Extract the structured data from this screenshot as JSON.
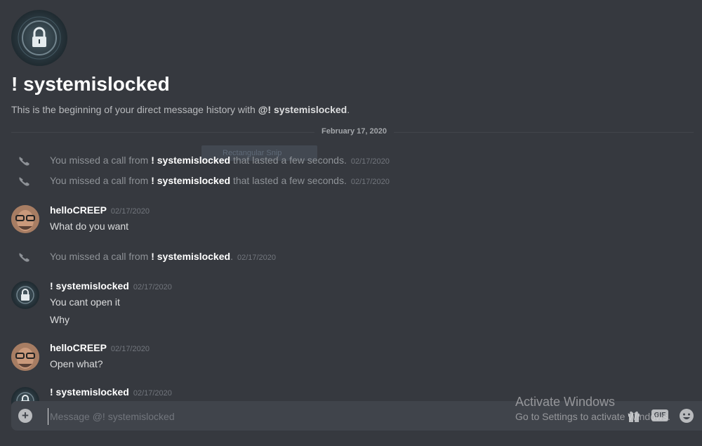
{
  "channel": {
    "title": "! systemislocked",
    "intro_prefix": "This is the beginning of your direct message history with ",
    "intro_mention": "@! systemislocked",
    "intro_suffix": "."
  },
  "divider": {
    "date": "February 17, 2020"
  },
  "ghost_tooltip": "Rectangular Snip",
  "calls": [
    {
      "prefix": "You missed a call from ",
      "user": "! systemislocked",
      "suffix": " that lasted a few seconds.",
      "timestamp": "02/17/2020"
    },
    {
      "prefix": "You missed a call from ",
      "user": "! systemislocked",
      "suffix": " that lasted a few seconds.",
      "timestamp": "02/17/2020"
    },
    {
      "prefix": "You missed a call from ",
      "user": "! systemislocked",
      "suffix": ".",
      "timestamp": "02/17/2020"
    }
  ],
  "messages": [
    {
      "author": "helloCREEP",
      "timestamp": "02/17/2020",
      "lines": [
        "What do you want"
      ]
    },
    {
      "author": "! systemislocked",
      "timestamp": "02/17/2020",
      "lines": [
        "You cant open it",
        "Why"
      ]
    },
    {
      "author": "helloCREEP",
      "timestamp": "02/17/2020",
      "lines": [
        "Open what?"
      ]
    },
    {
      "author": "! systemislocked",
      "timestamp": "02/17/2020",
      "lines": []
    }
  ],
  "composer": {
    "placeholder": "Message @! systemislocked",
    "gif_label": "GIF",
    "add_label": "+"
  },
  "watermark": {
    "line1": "Activate Windows",
    "line2": "Go to Settings to activate Windows."
  },
  "icons": {
    "call": "phone-missed-icon",
    "add": "plus-circle-icon",
    "gift": "gift-icon",
    "emoji": "smiley-icon"
  },
  "colors": {
    "background": "#36393f",
    "composer": "#40444b",
    "muted": "#8e9297",
    "timestamp": "#72767d"
  }
}
